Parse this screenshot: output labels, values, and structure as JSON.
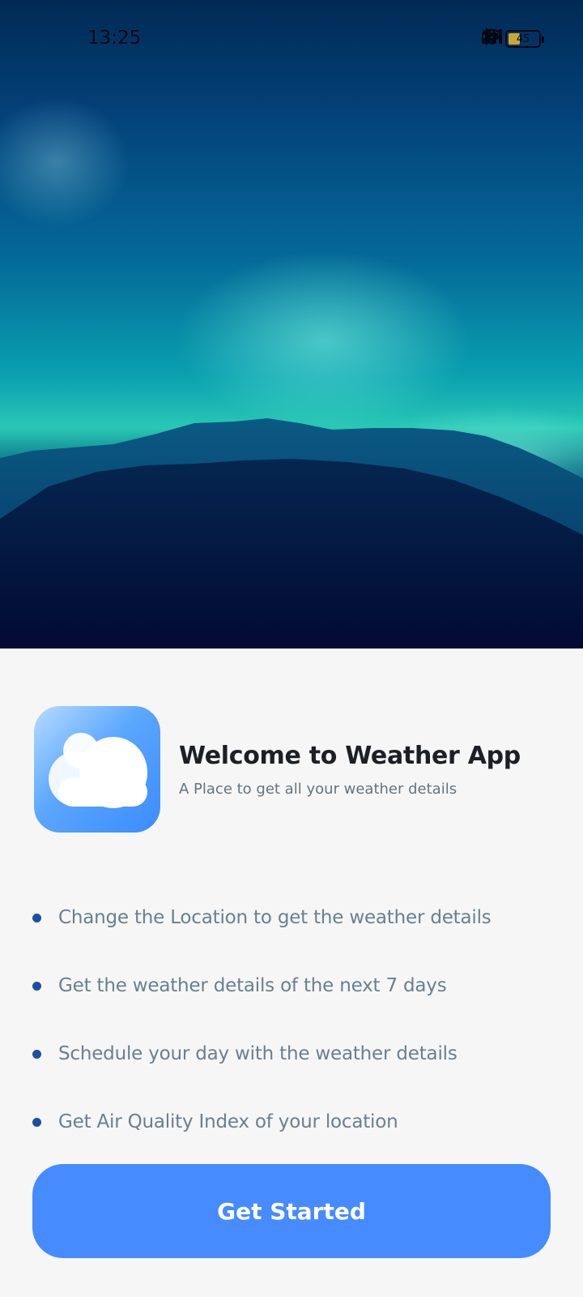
{
  "status_bar": {
    "time": "13:25",
    "icons": [
      "vibrate-icon",
      "bluetooth-icon",
      "wifi-icon",
      "volte-icon",
      "signal-icon",
      "signal-icon-2"
    ],
    "volte_label": "Vo LTE",
    "battery_level": 45,
    "battery_text": "45"
  },
  "hero": {
    "image": "mountain-night-sky-illustration"
  },
  "welcome": {
    "app_icon": "cloud-icon",
    "title": "Welcome to Weather App",
    "subtitle": "A Place to get all your weather details"
  },
  "features": [
    "Change the Location to get the weather details",
    "Get the weather details of the next 7 days",
    "Schedule your day with the weather details",
    "Get Air Quality Index of your location"
  ],
  "cta": {
    "label": "Get Started"
  },
  "colors": {
    "accent": "#468bff",
    "bullet": "#1c4fa3",
    "background": "#f6f6f6",
    "battery": "#c9a637"
  }
}
